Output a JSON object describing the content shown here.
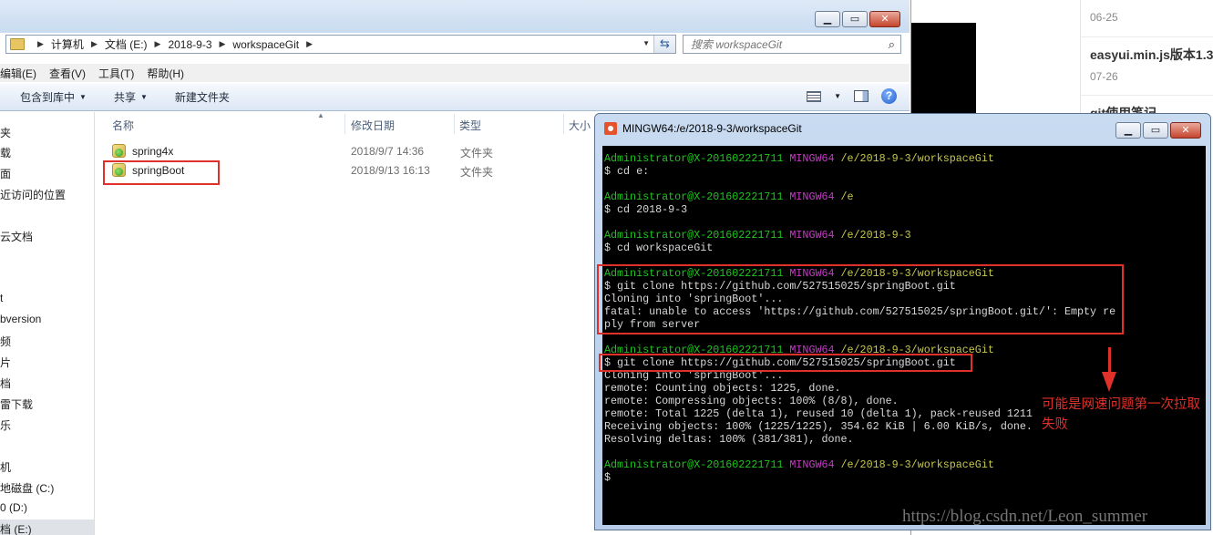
{
  "explorer": {
    "address": {
      "crumbs": [
        "计算机",
        "文档 (E:)",
        "2018-9-3",
        "workspaceGit"
      ]
    },
    "search": {
      "placeholder": "搜索 workspaceGit"
    },
    "menu": [
      "编辑(E)",
      "查看(V)",
      "工具(T)",
      "帮助(H)"
    ],
    "toolbar": {
      "include_label": "包含到库中",
      "share_label": "共享",
      "new_folder_label": "新建文件夹"
    },
    "nav": [
      "夹",
      "载",
      "面",
      "近访问的位置",
      "云文档",
      "t",
      "bversion",
      "频",
      "片",
      "档",
      "雷下载",
      "乐",
      "机",
      "地磁盘 (C:)",
      "0 (D:)",
      "档 (E:)"
    ],
    "columns": {
      "name": "名称",
      "date": "修改日期",
      "type": "类型",
      "size": "大小"
    },
    "files": [
      {
        "name": "spring4x",
        "date": "2018/9/7 14:36",
        "type": "文件夹"
      },
      {
        "name": "springBoot",
        "date": "2018/9/13 16:13",
        "type": "文件夹"
      }
    ]
  },
  "blog": {
    "items": [
      {
        "date": "06-25"
      },
      {
        "title": "easyui.min.js版本1.3",
        "date": "07-26"
      },
      {
        "title": "git使用笔记"
      }
    ]
  },
  "terminal": {
    "title": "MINGW64:/e/2018-9-3/workspaceGit",
    "prompt_user": "Administrator@X-201602221711",
    "prompt_env": "MINGW64",
    "lines": [
      {
        "type": "prompt",
        "path": "/e/2018-9-3/workspaceGit"
      },
      {
        "type": "out",
        "text": "$ cd e:"
      },
      {
        "type": "prompt",
        "path": "/e"
      },
      {
        "type": "out",
        "text": "$ cd 2018-9-3"
      },
      {
        "type": "prompt",
        "path": "/e/2018-9-3"
      },
      {
        "type": "out",
        "text": "$ cd workspaceGit"
      },
      {
        "type": "prompt",
        "path": "/e/2018-9-3/workspaceGit"
      },
      {
        "type": "out",
        "text": "$ git clone https://github.com/527515025/springBoot.git"
      },
      {
        "type": "out",
        "text": "Cloning into 'springBoot'..."
      },
      {
        "type": "out",
        "text": "fatal: unable to access 'https://github.com/527515025/springBoot.git/': Empty re"
      },
      {
        "type": "out",
        "text": "ply from server"
      },
      {
        "type": "prompt",
        "path": "/e/2018-9-3/workspaceGit"
      },
      {
        "type": "out",
        "text": "$ git clone https://github.com/527515025/springBoot.git"
      },
      {
        "type": "out",
        "text": "Cloning into 'springBoot'..."
      },
      {
        "type": "out",
        "text": "remote: Counting objects: 1225, done."
      },
      {
        "type": "out",
        "text": "remote: Compressing objects: 100% (8/8), done."
      },
      {
        "type": "out",
        "text": "remote: Total 1225 (delta 1), reused 10 (delta 1), pack-reused 1211"
      },
      {
        "type": "out",
        "text": "Receiving objects: 100% (1225/1225), 354.62 KiB | 6.00 KiB/s, done."
      },
      {
        "type": "out",
        "text": "Resolving deltas: 100% (381/381), done."
      },
      {
        "type": "prompt",
        "path": "/e/2018-9-3/workspaceGit"
      },
      {
        "type": "out",
        "text": "$"
      }
    ]
  },
  "annotation": {
    "text": "可能是网速问题第一次拉取失败"
  },
  "watermark": "https://blog.csdn.net/Leon_summer"
}
